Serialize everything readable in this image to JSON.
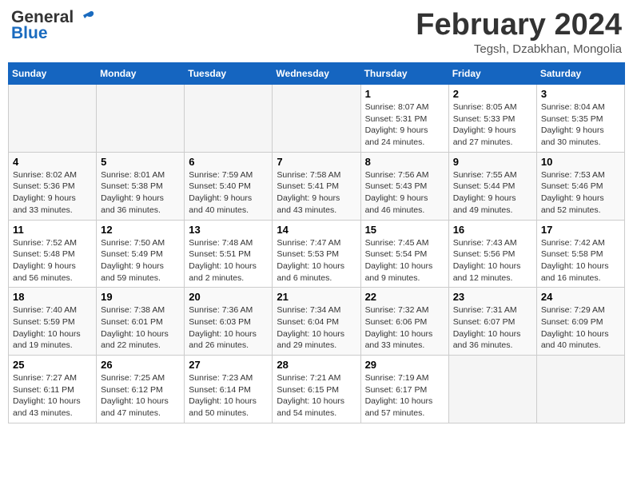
{
  "header": {
    "logo_general": "General",
    "logo_blue": "Blue",
    "month_title": "February 2024",
    "location": "Tegsh, Dzabkhan, Mongolia"
  },
  "calendar": {
    "days_of_week": [
      "Sunday",
      "Monday",
      "Tuesday",
      "Wednesday",
      "Thursday",
      "Friday",
      "Saturday"
    ],
    "weeks": [
      [
        {
          "day": "",
          "info": ""
        },
        {
          "day": "",
          "info": ""
        },
        {
          "day": "",
          "info": ""
        },
        {
          "day": "",
          "info": ""
        },
        {
          "day": "1",
          "info": "Sunrise: 8:07 AM\nSunset: 5:31 PM\nDaylight: 9 hours\nand 24 minutes."
        },
        {
          "day": "2",
          "info": "Sunrise: 8:05 AM\nSunset: 5:33 PM\nDaylight: 9 hours\nand 27 minutes."
        },
        {
          "day": "3",
          "info": "Sunrise: 8:04 AM\nSunset: 5:35 PM\nDaylight: 9 hours\nand 30 minutes."
        }
      ],
      [
        {
          "day": "4",
          "info": "Sunrise: 8:02 AM\nSunset: 5:36 PM\nDaylight: 9 hours\nand 33 minutes."
        },
        {
          "day": "5",
          "info": "Sunrise: 8:01 AM\nSunset: 5:38 PM\nDaylight: 9 hours\nand 36 minutes."
        },
        {
          "day": "6",
          "info": "Sunrise: 7:59 AM\nSunset: 5:40 PM\nDaylight: 9 hours\nand 40 minutes."
        },
        {
          "day": "7",
          "info": "Sunrise: 7:58 AM\nSunset: 5:41 PM\nDaylight: 9 hours\nand 43 minutes."
        },
        {
          "day": "8",
          "info": "Sunrise: 7:56 AM\nSunset: 5:43 PM\nDaylight: 9 hours\nand 46 minutes."
        },
        {
          "day": "9",
          "info": "Sunrise: 7:55 AM\nSunset: 5:44 PM\nDaylight: 9 hours\nand 49 minutes."
        },
        {
          "day": "10",
          "info": "Sunrise: 7:53 AM\nSunset: 5:46 PM\nDaylight: 9 hours\nand 52 minutes."
        }
      ],
      [
        {
          "day": "11",
          "info": "Sunrise: 7:52 AM\nSunset: 5:48 PM\nDaylight: 9 hours\nand 56 minutes."
        },
        {
          "day": "12",
          "info": "Sunrise: 7:50 AM\nSunset: 5:49 PM\nDaylight: 9 hours\nand 59 minutes."
        },
        {
          "day": "13",
          "info": "Sunrise: 7:48 AM\nSunset: 5:51 PM\nDaylight: 10 hours\nand 2 minutes."
        },
        {
          "day": "14",
          "info": "Sunrise: 7:47 AM\nSunset: 5:53 PM\nDaylight: 10 hours\nand 6 minutes."
        },
        {
          "day": "15",
          "info": "Sunrise: 7:45 AM\nSunset: 5:54 PM\nDaylight: 10 hours\nand 9 minutes."
        },
        {
          "day": "16",
          "info": "Sunrise: 7:43 AM\nSunset: 5:56 PM\nDaylight: 10 hours\nand 12 minutes."
        },
        {
          "day": "17",
          "info": "Sunrise: 7:42 AM\nSunset: 5:58 PM\nDaylight: 10 hours\nand 16 minutes."
        }
      ],
      [
        {
          "day": "18",
          "info": "Sunrise: 7:40 AM\nSunset: 5:59 PM\nDaylight: 10 hours\nand 19 minutes."
        },
        {
          "day": "19",
          "info": "Sunrise: 7:38 AM\nSunset: 6:01 PM\nDaylight: 10 hours\nand 22 minutes."
        },
        {
          "day": "20",
          "info": "Sunrise: 7:36 AM\nSunset: 6:03 PM\nDaylight: 10 hours\nand 26 minutes."
        },
        {
          "day": "21",
          "info": "Sunrise: 7:34 AM\nSunset: 6:04 PM\nDaylight: 10 hours\nand 29 minutes."
        },
        {
          "day": "22",
          "info": "Sunrise: 7:32 AM\nSunset: 6:06 PM\nDaylight: 10 hours\nand 33 minutes."
        },
        {
          "day": "23",
          "info": "Sunrise: 7:31 AM\nSunset: 6:07 PM\nDaylight: 10 hours\nand 36 minutes."
        },
        {
          "day": "24",
          "info": "Sunrise: 7:29 AM\nSunset: 6:09 PM\nDaylight: 10 hours\nand 40 minutes."
        }
      ],
      [
        {
          "day": "25",
          "info": "Sunrise: 7:27 AM\nSunset: 6:11 PM\nDaylight: 10 hours\nand 43 minutes."
        },
        {
          "day": "26",
          "info": "Sunrise: 7:25 AM\nSunset: 6:12 PM\nDaylight: 10 hours\nand 47 minutes."
        },
        {
          "day": "27",
          "info": "Sunrise: 7:23 AM\nSunset: 6:14 PM\nDaylight: 10 hours\nand 50 minutes."
        },
        {
          "day": "28",
          "info": "Sunrise: 7:21 AM\nSunset: 6:15 PM\nDaylight: 10 hours\nand 54 minutes."
        },
        {
          "day": "29",
          "info": "Sunrise: 7:19 AM\nSunset: 6:17 PM\nDaylight: 10 hours\nand 57 minutes."
        },
        {
          "day": "",
          "info": ""
        },
        {
          "day": "",
          "info": ""
        }
      ]
    ]
  }
}
